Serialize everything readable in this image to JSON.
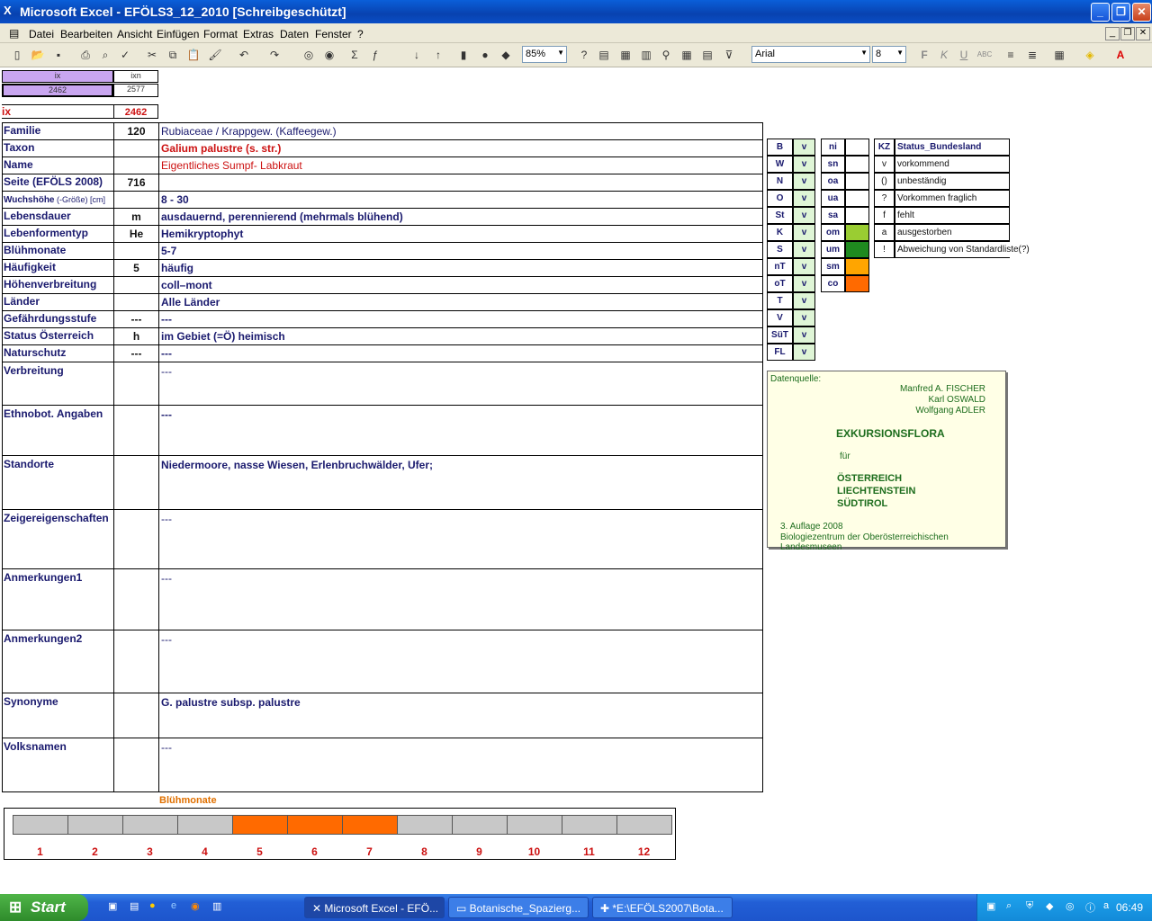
{
  "window": {
    "title": "Microsoft Excel - EFÖLS3_12_2010  [Schreibgeschützt]",
    "min": "_",
    "max": "❐",
    "close": "✕"
  },
  "menu": [
    "Datei",
    "Bearbeiten",
    "Ansicht",
    "Einfügen",
    "Format",
    "Extras",
    "Daten",
    "Fenster",
    "?"
  ],
  "toolbar": {
    "zoom": "85%",
    "font": "Arial",
    "size": "8"
  },
  "index": {
    "ix_label": "ix",
    "ixn_label": "ixn",
    "ix_value": "2462",
    "ixn_value": "2577",
    "ix_row_label": "ix",
    "ix_row_value": "2462"
  },
  "rows": [
    {
      "label": "Familie",
      "code": "120",
      "value": "Rubiaceae  /  Krappgew. (Kaffeegew.)"
    },
    {
      "label": "Taxon",
      "code": "",
      "value": "Galium palustre (s. str.)"
    },
    {
      "label": "Name",
      "code": "",
      "value": "Eigentliches Sumpf- Labkraut"
    },
    {
      "label": "Seite (EFÖLS 2008)",
      "code": "716",
      "value": ""
    },
    {
      "label": "Wuchshöhe",
      "label_small": " (-Größe) [cm]",
      "code": "",
      "value": " 8 - 30"
    },
    {
      "label": "Lebensdauer",
      "code": "m",
      "value": "ausdauernd, perennierend (mehrmals blühend)"
    },
    {
      "label": "Lebenformentyp",
      "code": "He",
      "value": "Hemikryptophyt"
    },
    {
      "label": "Blühmonate",
      "code": "",
      "value": " 5-7"
    },
    {
      "label": "Häufigkeit",
      "code": "5",
      "value": "häufig"
    },
    {
      "label": "Höhenverbreitung",
      "code": "",
      "value": "coll–mont"
    },
    {
      "label": "Länder",
      "code": "",
      "value": "Alle Länder"
    },
    {
      "label": "Gefährdungsstufe",
      "code": "---",
      "value": "  ---"
    },
    {
      "label": "Status Österreich",
      "code": "h",
      "value": "im Gebiet (=Ö) heimisch"
    },
    {
      "label": "Naturschutz",
      "code": "---",
      "value": " ---"
    },
    {
      "label": "Verbreitung",
      "code": "",
      "value": " ---"
    },
    {
      "label": "Ethnobot. Angaben",
      "code": "",
      "value": "---"
    },
    {
      "label": "Standorte",
      "code": "",
      "value": "Niedermoore, nasse Wiesen, Erlenbruchwälder, Ufer;"
    },
    {
      "label": "Zeigereigenschaften",
      "code": "",
      "value": "---"
    },
    {
      "label": "Anmerkungen1",
      "code": "",
      "value": "---"
    },
    {
      "label": "Anmerkungen2",
      "code": "",
      "value": "---"
    },
    {
      "label": "Synonyme",
      "code": "",
      "value": "G. palustre subsp. palustre"
    },
    {
      "label": "Volksnamen",
      "code": "",
      "value": "---"
    }
  ],
  "laender": [
    {
      "code": "B",
      "v": "v"
    },
    {
      "code": "W",
      "v": "v"
    },
    {
      "code": "N",
      "v": "v"
    },
    {
      "code": "O",
      "v": "v"
    },
    {
      "code": "St",
      "v": "v"
    },
    {
      "code": "K",
      "v": "v"
    },
    {
      "code": "S",
      "v": "v"
    },
    {
      "code": "nT",
      "v": "v"
    },
    {
      "code": "oT",
      "v": "v"
    },
    {
      "code": "T",
      "v": "v"
    },
    {
      "code": "V",
      "v": "v"
    },
    {
      "code": "SüT",
      "v": "v"
    },
    {
      "code": "FL",
      "v": "v"
    }
  ],
  "hoehen": [
    {
      "code": "ni",
      "color": ""
    },
    {
      "code": "sn",
      "color": ""
    },
    {
      "code": "oa",
      "color": ""
    },
    {
      "code": "ua",
      "color": ""
    },
    {
      "code": "sa",
      "color": ""
    },
    {
      "code": "om",
      "color": "#9acd32"
    },
    {
      "code": "um",
      "color": "#1f8a1f"
    },
    {
      "code": "sm",
      "color": "#ffa500"
    },
    {
      "code": "co",
      "color": "#ff6a00"
    }
  ],
  "status_legend": {
    "header_kz": "KZ",
    "header_title": "Status_Bundesland",
    "items": [
      {
        "kz": "v",
        "text": "vorkommend"
      },
      {
        "kz": "()",
        "text": "unbeständig"
      },
      {
        "kz": "?",
        "text": "Vorkommen fraglich"
      },
      {
        "kz": "f",
        "text": "fehlt"
      },
      {
        "kz": "a",
        "text": "ausgestorben"
      },
      {
        "kz": "!",
        "text": "Abweichung von Standardliste(?)"
      }
    ]
  },
  "source": {
    "label": "Datenquelle:",
    "authors": [
      "Manfred A. FISCHER",
      "Karl OSWALD",
      "Wolfgang ADLER"
    ],
    "title": "EXKURSIONSFLORA",
    "fuer": "für",
    "countries": [
      "ÖSTERREICH",
      "LIECHTENSTEIN",
      "SÜDTIROL"
    ],
    "edition": "3. Auflage 2008",
    "publisher": "Biologiezentrum der Oberösterreichischen Landesmuseen"
  },
  "bloom": {
    "title": "Blühmonate",
    "months": [
      "1",
      "2",
      "3",
      "4",
      "5",
      "6",
      "7",
      "8",
      "9",
      "10",
      "11",
      "12"
    ],
    "active": [
      5,
      6,
      7
    ]
  },
  "taskbar": {
    "start": "Start",
    "tasks": [
      "Microsoft Excel - EFÖ...",
      "Botanische_Spazierg...",
      "*E:\\EFÖLS2007\\Bota..."
    ],
    "clock": "06:49"
  }
}
